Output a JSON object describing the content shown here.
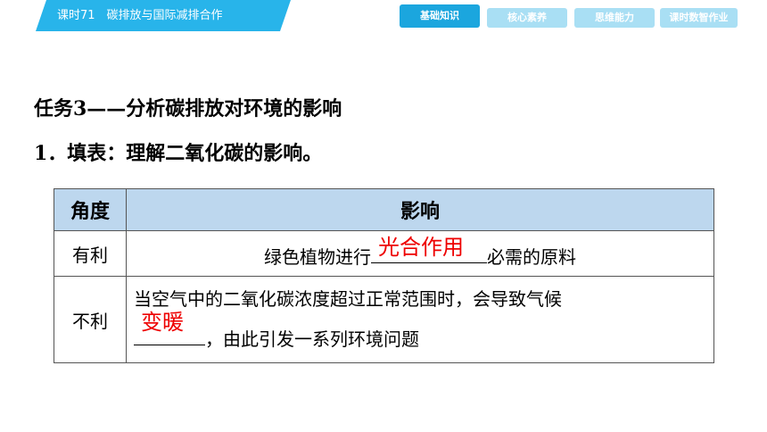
{
  "header": {
    "lesson_title": "课时71　碳排放与国际减排合作",
    "tabs": [
      {
        "label": "基础知识",
        "active": true
      },
      {
        "label": "核心素养",
        "active": false
      },
      {
        "label": "思维能力",
        "active": false
      },
      {
        "label": "课时数智作业",
        "active": false
      }
    ],
    "accent_color": "#28b4ea"
  },
  "content": {
    "section_heading": "任务3——分析碳排放对环境的影响",
    "subheading": "1．填表：理解二氧化碳的影响。",
    "table": {
      "headers": [
        "角度",
        "影响"
      ],
      "rows": [
        {
          "angle": "有利",
          "text_before": "绿色植物进行",
          "answer": "光合作用",
          "text_after": "必需的原料"
        },
        {
          "angle": "不利",
          "line1": "当空气中的二氧化碳浓度超过正常范围时，会导致气候",
          "answer": "变暖",
          "text_after": "，由此引发一系列环境问题"
        }
      ]
    }
  }
}
